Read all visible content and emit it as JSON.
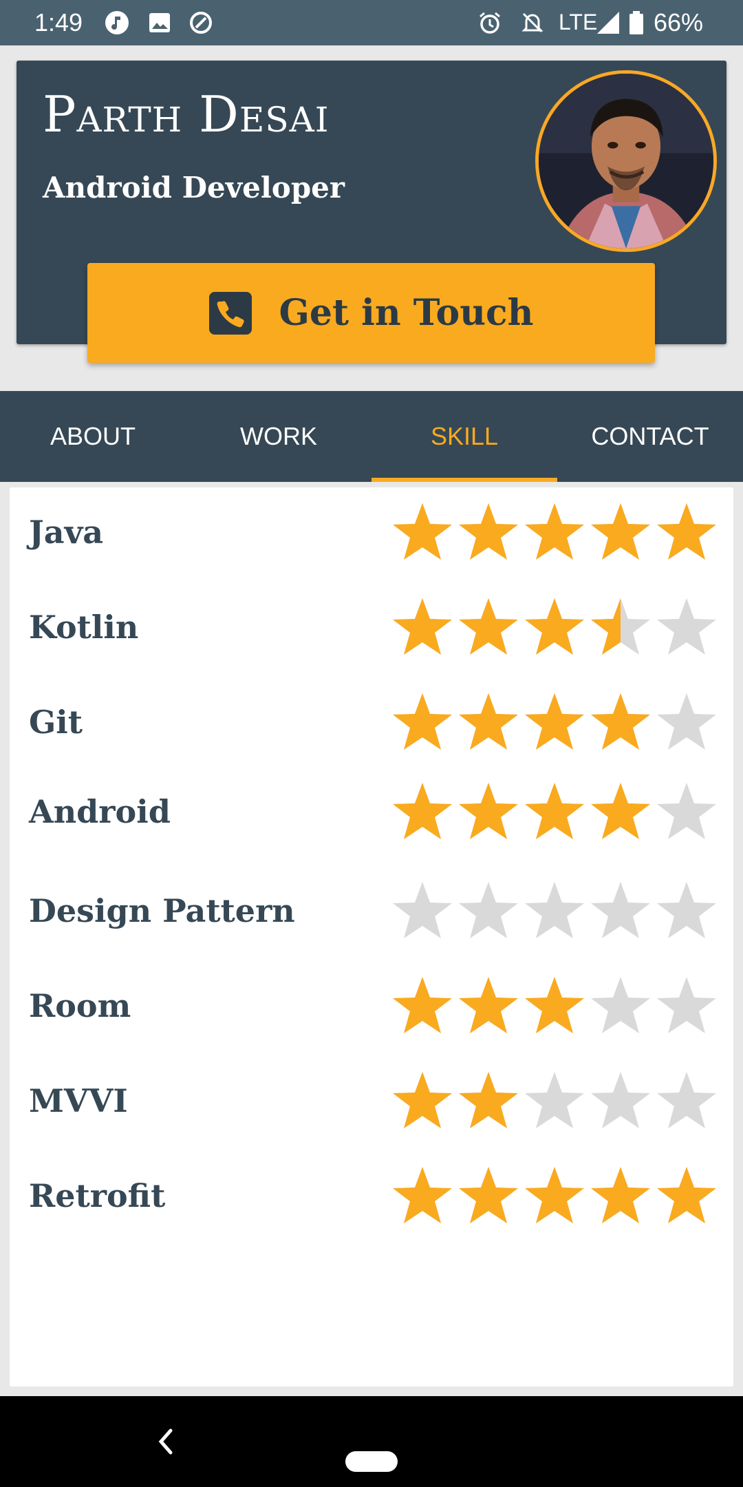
{
  "status_bar": {
    "time": "1:49",
    "network": "LTE",
    "battery": "66%"
  },
  "profile": {
    "name": "Parth Desai",
    "role": "Android Developer",
    "cta_label": "Get in Touch"
  },
  "tabs": [
    {
      "label": "ABOUT",
      "active": false
    },
    {
      "label": "WORK",
      "active": false
    },
    {
      "label": "SKILL",
      "active": true
    },
    {
      "label": "CONTACT",
      "active": false
    }
  ],
  "skills": [
    {
      "name": "Java",
      "rating": 5
    },
    {
      "name": "Kotlin",
      "rating": 3.5
    },
    {
      "name": "Git",
      "rating": 4
    },
    {
      "name": "Android",
      "rating": 4
    },
    {
      "name": "Design Pattern",
      "rating": 0
    },
    {
      "name": "Room",
      "rating": 3
    },
    {
      "name": "MVVI",
      "rating": 2
    },
    {
      "name": "Retrofit",
      "rating": 5
    }
  ],
  "colors": {
    "primary": "#364855",
    "accent": "#f9aa1f",
    "star_empty": "#d9d9d9"
  },
  "icons": {
    "status_left": [
      "music-icon",
      "image-icon",
      "sync-icon"
    ],
    "status_right": [
      "alarm-icon",
      "mute-icon",
      "signal-icon",
      "battery-icon"
    ],
    "cta": "phone-icon",
    "nav": [
      "back-icon",
      "home-pill-icon"
    ]
  }
}
